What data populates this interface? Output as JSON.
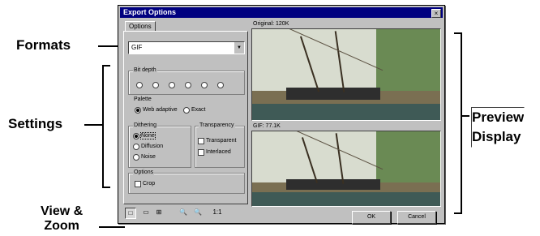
{
  "callouts": {
    "formats": "Formats",
    "settings": "Settings",
    "view_zoom": [
      "View &",
      "Zoom"
    ],
    "preview": [
      "Preview",
      "Display"
    ]
  },
  "dialog": {
    "title": "Export Options",
    "close_glyph": "×",
    "tab": "Options",
    "format_value": "GIF",
    "dropdown_glyph": "▼",
    "groups": {
      "depth": "Bit depth",
      "palette": "Palette",
      "dither": "Dithering",
      "transparency": "Transparency",
      "options": "Options"
    },
    "palette_options": [
      {
        "label": "Web adaptive",
        "checked": true
      },
      {
        "label": "Exact",
        "checked": false
      }
    ],
    "dither_options": [
      {
        "label": "None",
        "checked": true,
        "boxed": true
      },
      {
        "label": "Diffusion",
        "checked": false,
        "boxed": false
      },
      {
        "label": "Noise",
        "checked": false,
        "boxed": false
      }
    ],
    "transparency_options": [
      {
        "label": "Transparent",
        "checked": false
      },
      {
        "label": "Interlaced",
        "checked": false
      }
    ],
    "options_options": [
      {
        "label": "Crop",
        "checked": false
      }
    ],
    "preview_labels": [
      "Original: 120K",
      "GIF: 77.1K"
    ],
    "toolbar": [
      "□",
      "▭",
      "⊞",
      "🔍",
      "🔍",
      "1:1"
    ],
    "ok": "OK",
    "cancel": "Cancel"
  }
}
